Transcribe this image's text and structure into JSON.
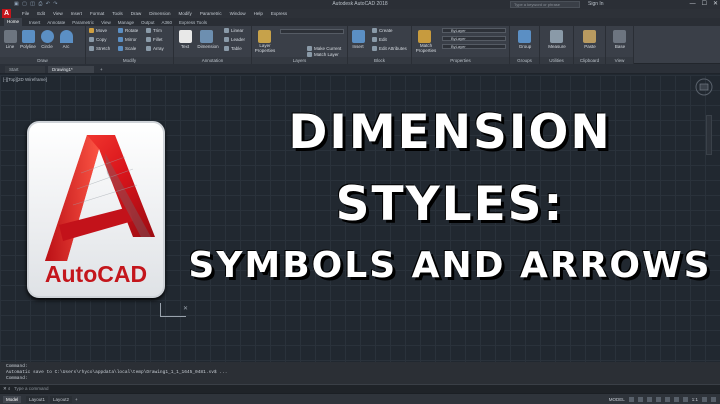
{
  "window": {
    "title": "Autodesk AutoCAD 2018",
    "search_placeholder": "Type a keyword or phrase",
    "user": "Sign In",
    "min": "—",
    "max": "☐",
    "close": "✕"
  },
  "menu": [
    "File",
    "Edit",
    "View",
    "Insert",
    "Format",
    "Tools",
    "Draw",
    "Dimension",
    "Modify",
    "Parametric",
    "Window",
    "Help",
    "Express"
  ],
  "ribbon_tabs": [
    "Home",
    "Insert",
    "Annotate",
    "Parametric",
    "View",
    "Manage",
    "Output",
    "A360",
    "Express Tools"
  ],
  "ribbon": {
    "draw": {
      "title": "Draw",
      "line": "Line",
      "polyline": "Polyline",
      "circle": "Circle",
      "arc": "Arc"
    },
    "modify": {
      "title": "Modify",
      "move": "Move",
      "rotate": "Rotate",
      "trim": "Trim",
      "copy": "Copy",
      "mirror": "Mirror",
      "fillet": "Fillet",
      "stretch": "Stretch",
      "scale": "Scale",
      "array": "Array"
    },
    "annotation": {
      "title": "Annotation",
      "text": "Text",
      "dimension": "Dimension",
      "linear": "Linear",
      "leader": "Leader",
      "table": "Table"
    },
    "layers": {
      "title": "Layers",
      "layer_properties": "Layer Properties",
      "make_current": "Make Current",
      "match_layer": "Match Layer"
    },
    "block": {
      "title": "Block",
      "insert": "Insert",
      "create": "Create",
      "edit": "Edit",
      "edit_attributes": "Edit Attributes"
    },
    "properties": {
      "title": "Properties",
      "match_properties": "Match Properties",
      "bylayer1": "ByLayer",
      "bylayer2": "ByLayer",
      "bylayer3": "ByLayer"
    },
    "groups": {
      "title": "Groups",
      "group": "Group"
    },
    "utilities": {
      "title": "Utilities",
      "measure": "Measure"
    },
    "clipboard": {
      "title": "Clipboard",
      "paste": "Paste"
    },
    "view": {
      "title": "View",
      "base": "Base"
    }
  },
  "doc_tabs": {
    "start": "Start",
    "drawing": "Drawing1*",
    "plus": "+"
  },
  "viewport": {
    "label": "[-][Top][2D Wireframe]",
    "viewcube": "TOP"
  },
  "logo": {
    "brand": "AutoCAD"
  },
  "headline": {
    "line1": "DIMENSION",
    "line2": "STYLES:",
    "line3": "SYMBOLS AND ARROWS"
  },
  "command": {
    "history": [
      "Command:",
      "Automatic save to C:\\Users\\rhyco\\appdata\\local\\temp\\Drawing1_1_1_1645_0481.sv$ ...",
      "Command:"
    ],
    "placeholder": "Type a command"
  },
  "status": {
    "model_tab": "Model",
    "layout1": "Layout1",
    "layout2": "Layout2",
    "plus": "+",
    "model_label": "MODEL",
    "scale": "1:1"
  }
}
